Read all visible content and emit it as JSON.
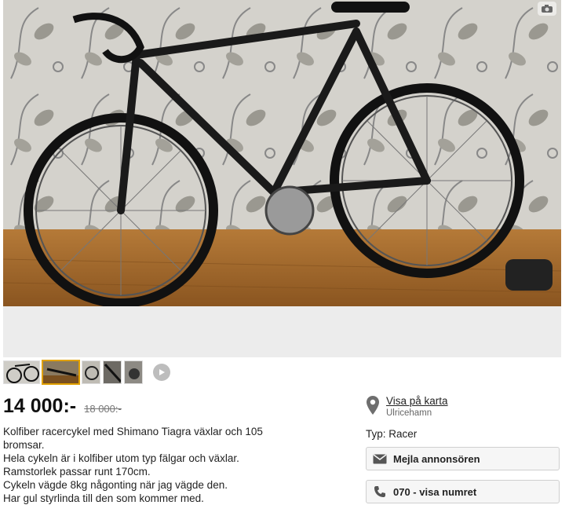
{
  "price": {
    "current": "14 000:-",
    "previous": "18 000:-"
  },
  "description": [
    "Kolfiber racercykel med Shimano Tiagra växlar och 105\nbromsar.",
    "Hela cykeln är i kolfiber utom typ fälgar och växlar.",
    "Ramstorlek passar runt 170cm.",
    "Cykeln vägde 8kg någonting när jag vägde den.",
    "Har gul styrlinda till den som kommer med."
  ],
  "location": {
    "link": "Visa på karta",
    "city": "Ulricehamn",
    "icon": "map-pin-icon"
  },
  "type": "Typ: Racer",
  "buttons": {
    "mail": {
      "label": "Mejla annonsören",
      "icon": "envelope-icon"
    },
    "phone": {
      "label": "070 - visa numret",
      "icon": "phone-icon"
    }
  },
  "gallery": {
    "thumbnails": 5,
    "selected": 1,
    "video_icon": "play-icon"
  },
  "colors": {
    "text": "#222222",
    "muted": "#777777",
    "button_bg": "#f6f6f6",
    "icon": "#555555"
  }
}
